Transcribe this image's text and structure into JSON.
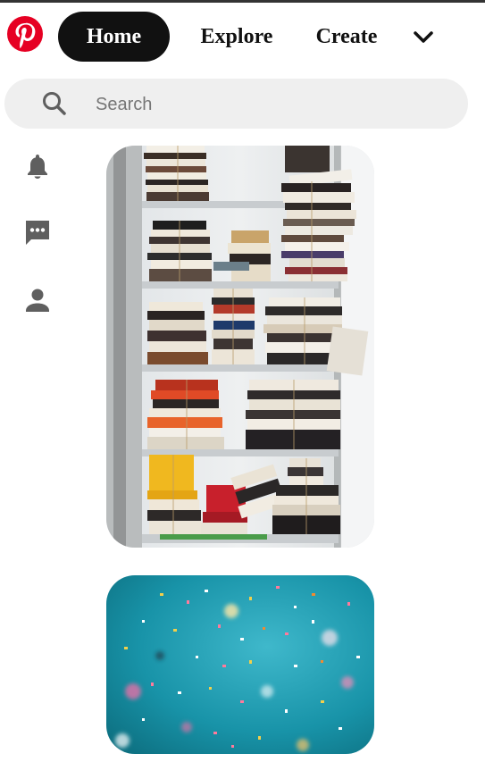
{
  "header": {
    "logo_icon": "pinterest-logo-icon",
    "brand_color": "#e60023",
    "tabs": [
      {
        "label": "Home",
        "active": true
      },
      {
        "label": "Explore",
        "active": false
      },
      {
        "label": "Create",
        "active": false
      }
    ],
    "menu_icon": "chevron-down-icon"
  },
  "search": {
    "icon": "search-icon",
    "placeholder": "Search"
  },
  "sidebar": {
    "items": [
      {
        "icon": "bell-icon"
      },
      {
        "icon": "chat-icon"
      },
      {
        "icon": "profile-icon"
      }
    ]
  },
  "feed": {
    "pins": [
      {
        "image": "stacked-books-on-shelves",
        "colors": [
          "#e8e8e8",
          "#c73a1e",
          "#f0b81f",
          "#1c1c1c"
        ]
      },
      {
        "image": "teal-confetti",
        "colors": [
          "#1893a8",
          "#f26fa8",
          "#ffffff"
        ]
      }
    ]
  }
}
